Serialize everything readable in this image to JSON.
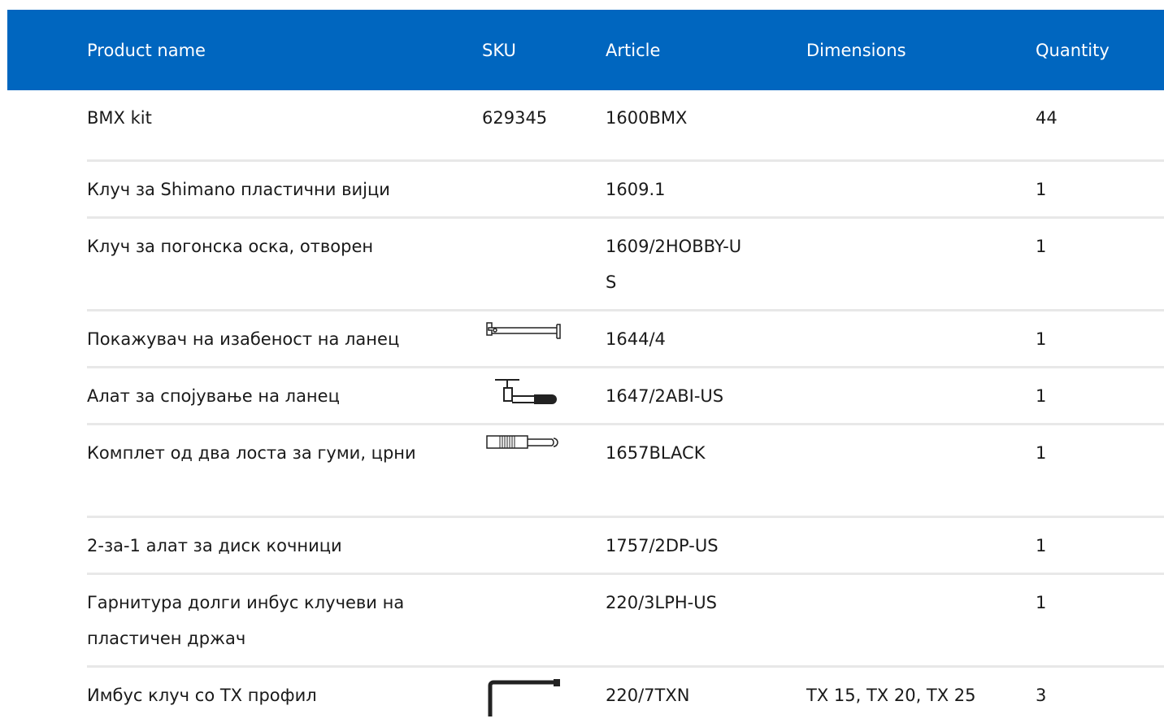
{
  "table": {
    "headers": {
      "product_name": "Product name",
      "sku": "SKU",
      "article": "Article",
      "dimensions": "Dimensions",
      "quantity": "Quantity"
    },
    "rows": [
      {
        "product_name": "BMX kit",
        "sku": "629345",
        "article": "1600BMX",
        "dimensions": "",
        "quantity": "44",
        "icon": ""
      },
      {
        "product_name": "Клуч за Shimano пластични вијци",
        "sku": "",
        "article": "1609.1",
        "dimensions": "",
        "quantity": "1",
        "icon": ""
      },
      {
        "product_name": "Клуч за погонска оска, отворен",
        "sku": "",
        "article": "1609/2HOBBY-US",
        "dimensions": "",
        "quantity": "1",
        "icon": ""
      },
      {
        "product_name": "Покажувач на изабеност на ланец",
        "sku": "",
        "article": "1644/4",
        "dimensions": "",
        "quantity": "1",
        "icon": "chain-wear-gauge-icon"
      },
      {
        "product_name": "Алат за спојување на ланец",
        "sku": "",
        "article": "1647/2ABI-US",
        "dimensions": "",
        "quantity": "1",
        "icon": "chain-tool-icon"
      },
      {
        "product_name": "Комплет од два лоста за гуми, црни",
        "sku": "",
        "article": "1657BLACK",
        "dimensions": "",
        "quantity": "1",
        "icon": "tire-lever-icon"
      },
      {
        "product_name": "2-за-1 алат за диск кочници",
        "sku": "",
        "article": "1757/2DP-US",
        "dimensions": "",
        "quantity": "1",
        "icon": ""
      },
      {
        "product_name": "Гарнитура долги инбус клучеви на пластичен држач",
        "sku": "",
        "article": "220/3LPH-US",
        "dimensions": "",
        "quantity": "1",
        "icon": ""
      },
      {
        "product_name": "Имбус клуч со ТХ профил",
        "sku": "",
        "article": "220/7TXN",
        "dimensions": "TX 15, TX 20, TX 25",
        "quantity": "3",
        "icon": "torx-key-icon"
      }
    ]
  }
}
